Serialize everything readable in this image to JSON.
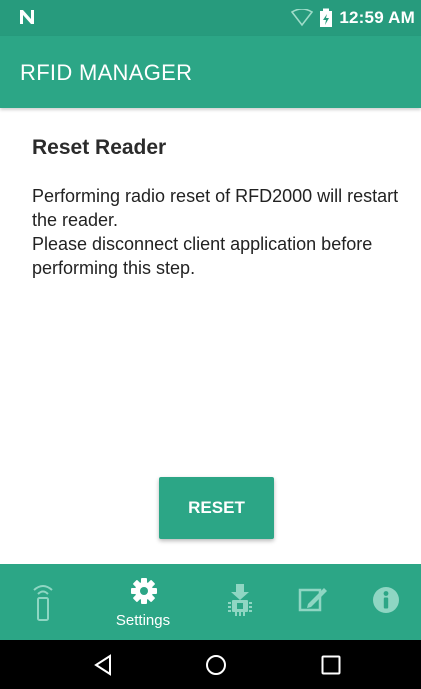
{
  "status_bar": {
    "time": "12:59 AM",
    "icons": [
      "android-n-icon",
      "wifi-icon",
      "battery-icon"
    ]
  },
  "app_bar": {
    "title": "RFID MANAGER"
  },
  "content": {
    "title": "Reset Reader",
    "body": "Performing radio reset of RFD2000 will restart the reader.\nPlease disconnect client application before performing this step.",
    "reset_label": "RESET"
  },
  "bottom_nav": {
    "items": [
      {
        "name": "reader",
        "icon": "rfid-reader-icon",
        "label": ""
      },
      {
        "name": "settings",
        "icon": "gear-icon",
        "label": "Settings",
        "selected": true
      },
      {
        "name": "firmware",
        "icon": "firmware-update-icon",
        "label": ""
      },
      {
        "name": "notes",
        "icon": "edit-note-icon",
        "label": ""
      },
      {
        "name": "info",
        "icon": "info-icon",
        "label": ""
      }
    ]
  },
  "colors": {
    "primary": "#2ca686",
    "primary_dark": "#279b7d",
    "nav_icon_inactive": "#8fd6c3",
    "text": "#222222"
  }
}
